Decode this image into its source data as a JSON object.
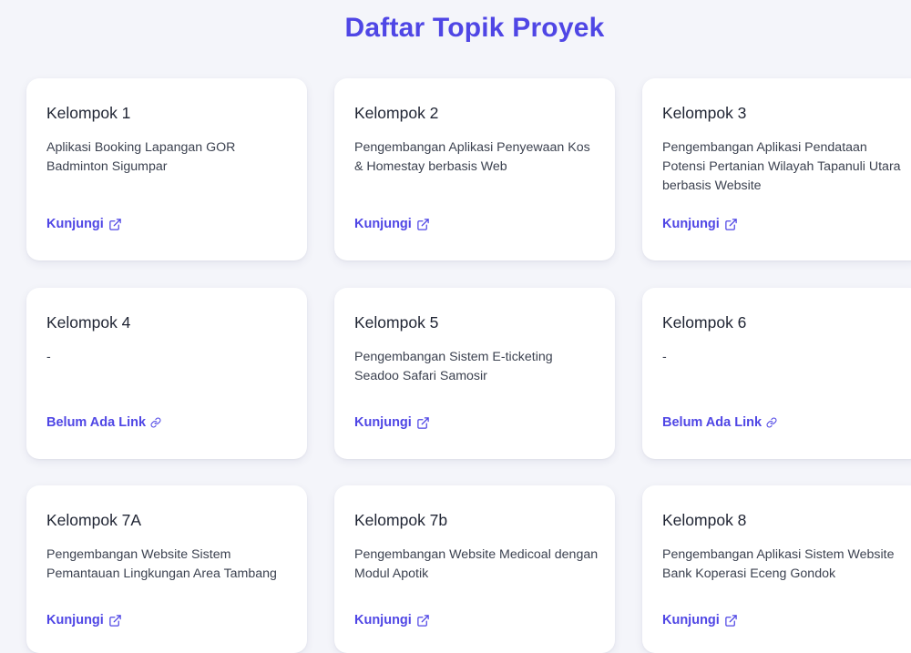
{
  "page": {
    "title": "Daftar Topik Proyek"
  },
  "colors": {
    "accent": "#4f46e5",
    "background": "#f4f5fa",
    "card": "#ffffff",
    "text": "#1f2433"
  },
  "cards": [
    {
      "title": "Kelompok 1",
      "description": "Aplikasi Booking Lapangan GOR Badminton Sigumpar",
      "link_label": "Kunjungi",
      "link_icon": "external-link-icon"
    },
    {
      "title": "Kelompok 2",
      "description": "Pengembangan Aplikasi Penyewaan Kos & Homestay berbasis Web",
      "link_label": "Kunjungi",
      "link_icon": "external-link-icon"
    },
    {
      "title": "Kelompok 3",
      "description": "Pengembangan Aplikasi Pendataan Potensi Pertanian Wilayah Tapanuli Utara berbasis Website",
      "link_label": "Kunjungi",
      "link_icon": "external-link-icon"
    },
    {
      "title": "Kelompok 4",
      "description": "-",
      "link_label": "Belum Ada Link",
      "link_icon": "link-icon"
    },
    {
      "title": "Kelompok 5",
      "description": "Pengembangan Sistem E-ticketing Seadoo Safari Samosir",
      "link_label": "Kunjungi",
      "link_icon": "external-link-icon"
    },
    {
      "title": "Kelompok 6",
      "description": "-",
      "link_label": "Belum Ada Link",
      "link_icon": "link-icon"
    },
    {
      "title": "Kelompok 7A",
      "description": "Pengembangan Website Sistem Pemantauan Lingkungan Area Tambang",
      "link_label": "Kunjungi",
      "link_icon": "external-link-icon"
    },
    {
      "title": "Kelompok 7b",
      "description": "Pengembangan Website Medicoal dengan Modul Apotik",
      "link_label": "Kunjungi",
      "link_icon": "external-link-icon"
    },
    {
      "title": "Kelompok 8",
      "description": "Pengembangan Aplikasi Sistem Website Bank Koperasi Eceng Gondok",
      "link_label": "Kunjungi",
      "link_icon": "external-link-icon"
    }
  ]
}
